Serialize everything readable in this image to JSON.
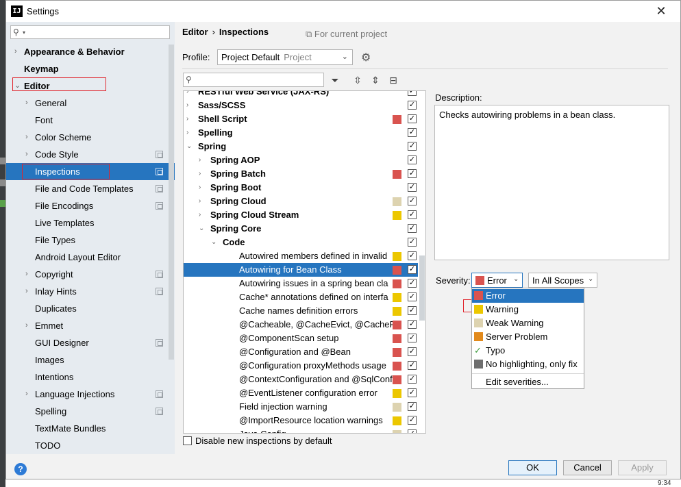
{
  "window": {
    "title": "Settings",
    "close_glyph": "✕"
  },
  "sidebar": {
    "search_placeholder": "",
    "items": [
      {
        "label": "Appearance & Behavior",
        "bold": true,
        "expandable": true,
        "project": false,
        "selected": false
      },
      {
        "label": "Keymap",
        "bold": true,
        "expandable": false,
        "project": false,
        "selected": false
      },
      {
        "label": "Editor",
        "bold": true,
        "expandable": true,
        "expanded": true,
        "project": false,
        "selected": false
      },
      {
        "label": "General",
        "expandable": true,
        "project": false,
        "selected": false
      },
      {
        "label": "Font",
        "expandable": false,
        "project": false,
        "selected": false
      },
      {
        "label": "Color Scheme",
        "expandable": true,
        "project": false,
        "selected": false
      },
      {
        "label": "Code Style",
        "expandable": true,
        "project": true,
        "selected": false
      },
      {
        "label": "Inspections",
        "expandable": false,
        "project": true,
        "selected": true
      },
      {
        "label": "File and Code Templates",
        "expandable": false,
        "project": true,
        "selected": false
      },
      {
        "label": "File Encodings",
        "expandable": false,
        "project": true,
        "selected": false
      },
      {
        "label": "Live Templates",
        "expandable": false,
        "project": false,
        "selected": false
      },
      {
        "label": "File Types",
        "expandable": false,
        "project": false,
        "selected": false
      },
      {
        "label": "Android Layout Editor",
        "expandable": false,
        "project": false,
        "selected": false
      },
      {
        "label": "Copyright",
        "expandable": true,
        "project": true,
        "selected": false
      },
      {
        "label": "Inlay Hints",
        "expandable": true,
        "project": true,
        "selected": false
      },
      {
        "label": "Duplicates",
        "expandable": false,
        "project": false,
        "selected": false
      },
      {
        "label": "Emmet",
        "expandable": true,
        "project": false,
        "selected": false
      },
      {
        "label": "GUI Designer",
        "expandable": false,
        "project": true,
        "selected": false
      },
      {
        "label": "Images",
        "expandable": false,
        "project": false,
        "selected": false
      },
      {
        "label": "Intentions",
        "expandable": false,
        "project": false,
        "selected": false
      },
      {
        "label": "Language Injections",
        "expandable": true,
        "project": true,
        "selected": false
      },
      {
        "label": "Spelling",
        "expandable": false,
        "project": true,
        "selected": false
      },
      {
        "label": "TextMate Bundles",
        "expandable": false,
        "project": false,
        "selected": false
      },
      {
        "label": "TODO",
        "expandable": false,
        "project": false,
        "selected": false
      }
    ]
  },
  "breadcrumb": {
    "root": "Editor",
    "separator": "›",
    "current": "Inspections"
  },
  "scope_hint": "For current project",
  "profile": {
    "label": "Profile:",
    "value": "Project Default",
    "kind": "Project"
  },
  "colors": {
    "error": "#d9534f",
    "warning": "#ecc700",
    "weak_warning": "#ddd3b0",
    "server_problem": "#e28a1c",
    "no_highlight": "#6e6e6e",
    "selection": "#2675bf"
  },
  "tree": {
    "rows": [
      {
        "label": "RESTful Web Service (JAX-RS)",
        "level": 0,
        "arrow": "›",
        "bold": true,
        "severity": null,
        "checked": true
      },
      {
        "label": "Sass/SCSS",
        "level": 0,
        "arrow": "›",
        "bold": true,
        "severity": null,
        "checked": true
      },
      {
        "label": "Shell Script",
        "level": 0,
        "arrow": "›",
        "bold": true,
        "severity": "error",
        "checked": true
      },
      {
        "label": "Spelling",
        "level": 0,
        "arrow": "›",
        "bold": true,
        "severity": null,
        "checked": true
      },
      {
        "label": "Spring",
        "level": 0,
        "arrow": "⌄",
        "bold": true,
        "severity": null,
        "checked": true
      },
      {
        "label": "Spring AOP",
        "level": 1,
        "arrow": "›",
        "bold": true,
        "severity": null,
        "checked": true
      },
      {
        "label": "Spring Batch",
        "level": 1,
        "arrow": "›",
        "bold": true,
        "severity": "error",
        "checked": true
      },
      {
        "label": "Spring Boot",
        "level": 1,
        "arrow": "›",
        "bold": true,
        "severity": null,
        "checked": true
      },
      {
        "label": "Spring Cloud",
        "level": 1,
        "arrow": "›",
        "bold": true,
        "severity": "weak_warning",
        "checked": true
      },
      {
        "label": "Spring Cloud Stream",
        "level": 1,
        "arrow": "›",
        "bold": true,
        "severity": "warning",
        "checked": true
      },
      {
        "label": "Spring Core",
        "level": 1,
        "arrow": "⌄",
        "bold": true,
        "severity": null,
        "checked": true
      },
      {
        "label": "Code",
        "level": 2,
        "arrow": "⌄",
        "bold": true,
        "severity": null,
        "checked": true
      },
      {
        "label": "Autowired members defined in invalid",
        "level": 3,
        "arrow": "",
        "bold": false,
        "severity": "warning",
        "checked": true
      },
      {
        "label": "Autowiring for Bean Class",
        "level": 3,
        "arrow": "",
        "bold": false,
        "severity": "error",
        "checked": true,
        "selected": true
      },
      {
        "label": "Autowiring issues in a spring bean cla",
        "level": 3,
        "arrow": "",
        "bold": false,
        "severity": "error",
        "checked": true
      },
      {
        "label": "Cache* annotations defined on interfa",
        "level": 3,
        "arrow": "",
        "bold": false,
        "severity": "warning",
        "checked": true
      },
      {
        "label": "Cache names definition errors",
        "level": 3,
        "arrow": "",
        "bold": false,
        "severity": "warning",
        "checked": true
      },
      {
        "label": "@Cacheable, @CacheEvict, @CachePu",
        "level": 3,
        "arrow": "",
        "bold": false,
        "severity": "error",
        "checked": true
      },
      {
        "label": "@ComponentScan setup",
        "level": 3,
        "arrow": "",
        "bold": false,
        "severity": "error",
        "checked": true
      },
      {
        "label": "@Configuration and @Bean",
        "level": 3,
        "arrow": "",
        "bold": false,
        "severity": "error",
        "checked": true
      },
      {
        "label": "@Configuration proxyMethods usage",
        "level": 3,
        "arrow": "",
        "bold": false,
        "severity": "error",
        "checked": true
      },
      {
        "label": "@ContextConfiguration and @SqlConf",
        "level": 3,
        "arrow": "",
        "bold": false,
        "severity": "error",
        "checked": true
      },
      {
        "label": "@EventListener configuration error",
        "level": 3,
        "arrow": "",
        "bold": false,
        "severity": "warning",
        "checked": true
      },
      {
        "label": "Field injection warning",
        "level": 3,
        "arrow": "",
        "bold": false,
        "severity": "weak_warning",
        "checked": true
      },
      {
        "label": "@ImportResource location warnings",
        "level": 3,
        "arrow": "",
        "bold": false,
        "severity": "warning",
        "checked": true
      },
      {
        "label": "Java Config",
        "level": 3,
        "arrow": "",
        "bold": false,
        "severity": "weak_warning",
        "checked": true
      }
    ]
  },
  "disable_new": {
    "label": "Disable new inspections by default",
    "checked": false
  },
  "description": {
    "label": "Description:",
    "text": "Checks autowiring problems in a bean class."
  },
  "severity": {
    "label": "Severity:",
    "value": "Error",
    "scope": "In All Scopes",
    "options": [
      {
        "label": "Error",
        "color_key": "error",
        "selected": true
      },
      {
        "label": "Warning",
        "color_key": "warning",
        "selected": false
      },
      {
        "label": "Weak Warning",
        "color_key": "weak_warning",
        "selected": false
      },
      {
        "label": "Server Problem",
        "color_key": "server_problem",
        "selected": false
      },
      {
        "label": "Typo",
        "color_key": "typo",
        "selected": false
      },
      {
        "label": "No highlighting, only fix",
        "color_key": "no_highlight",
        "selected": false
      }
    ],
    "edit_label": "Edit severities..."
  },
  "footer": {
    "help": "?",
    "ok": "OK",
    "cancel": "Cancel",
    "apply": "Apply"
  },
  "background": {
    "clock_fragment": "9:34"
  }
}
